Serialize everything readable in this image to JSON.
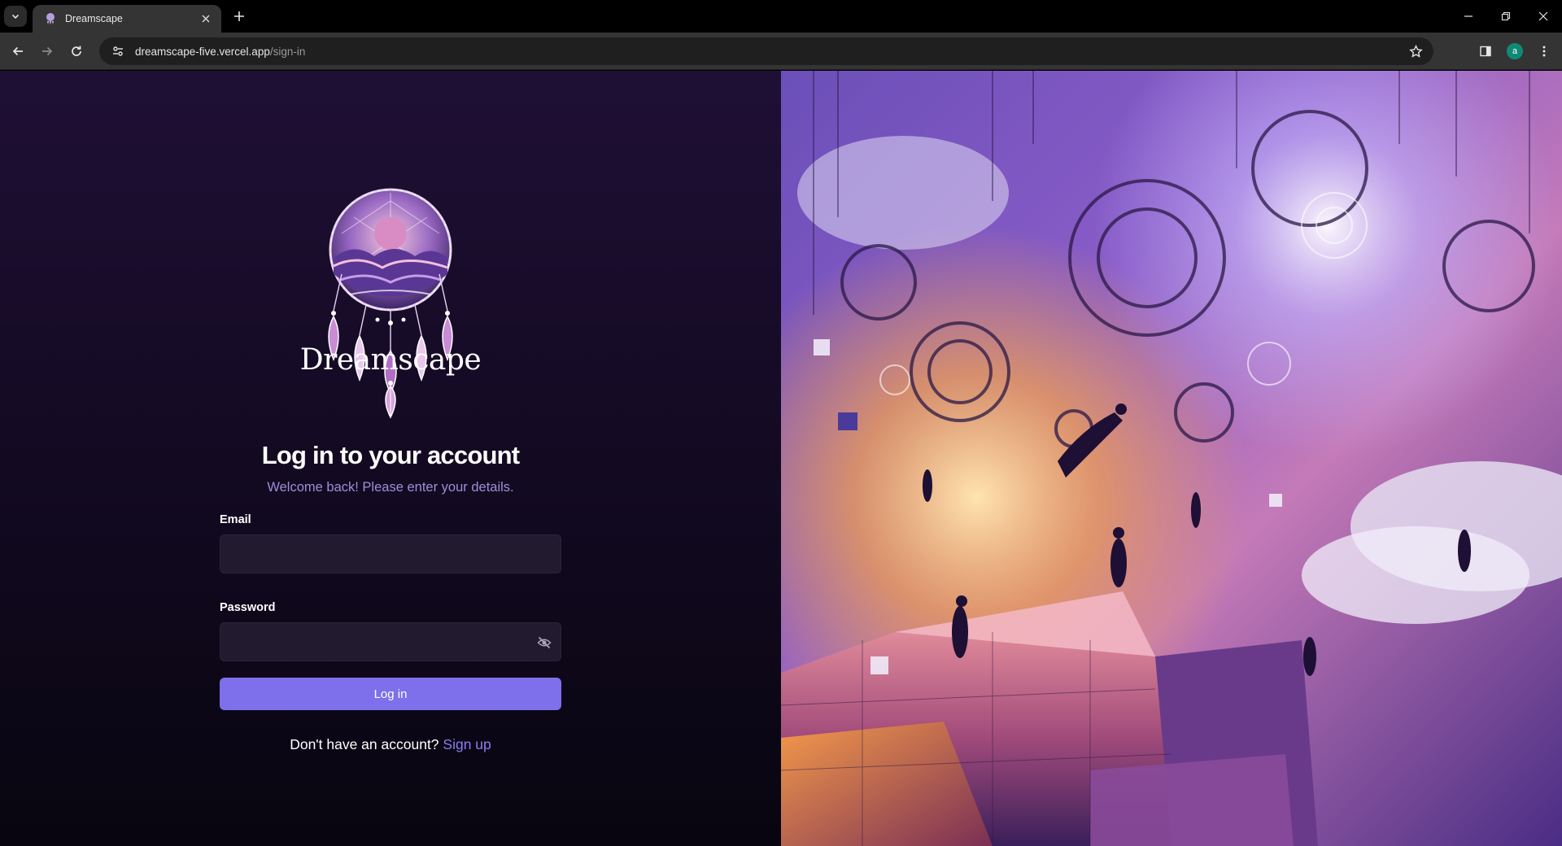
{
  "browser": {
    "tab_title": "Dreamscape",
    "url_host": "dreamscape-five.vercel.app",
    "url_path": "/sign-in",
    "profile_initial": "a",
    "profile_color": "#0f8a75"
  },
  "brand": {
    "name": "Dreamscape"
  },
  "login": {
    "heading": "Log in to your account",
    "subtitle": "Welcome back! Please enter your details.",
    "email_label": "Email",
    "email_value": "",
    "password_label": "Password",
    "password_value": "",
    "submit_label": "Log in",
    "signup_prompt": "Don't have an account?",
    "signup_link": "Sign up"
  },
  "colors": {
    "accent": "#7d70ea",
    "link": "#8b7cf0",
    "subtitle": "#9c8fd9",
    "background_top": "#1f0f35",
    "background_bottom": "#080510"
  }
}
